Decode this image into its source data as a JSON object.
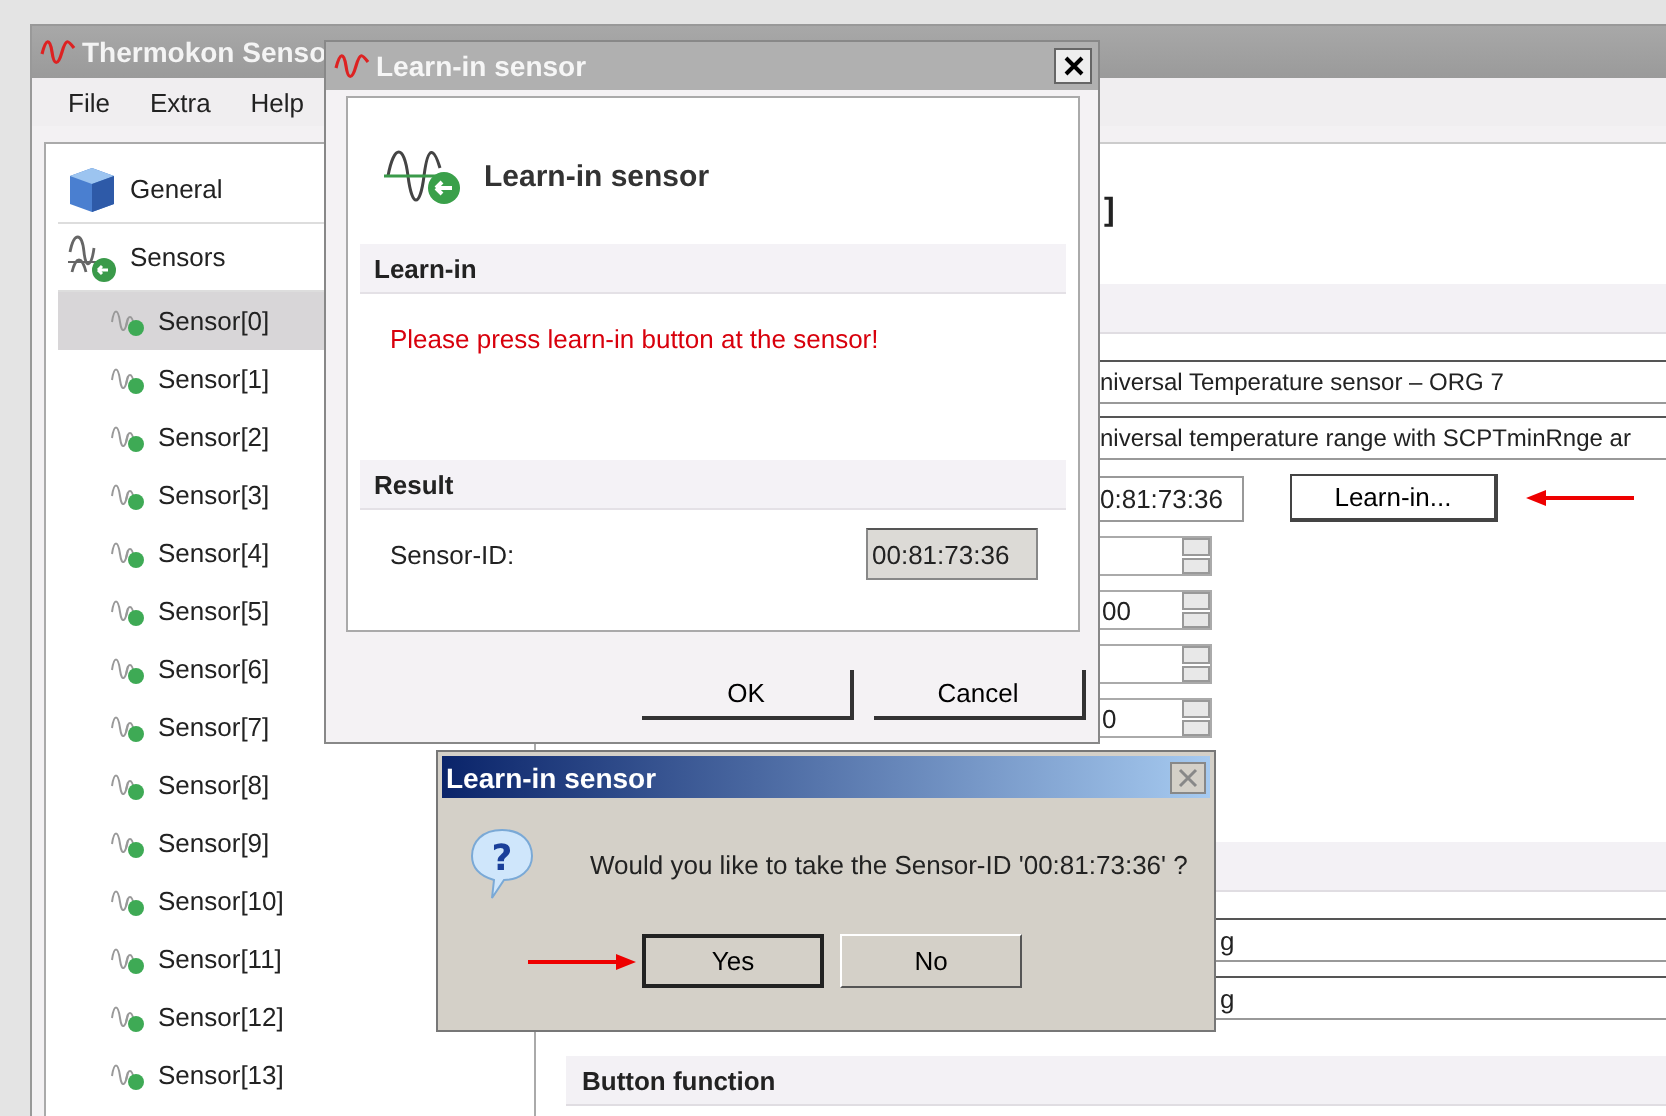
{
  "main_window": {
    "title": "Thermokon Senso",
    "menu": [
      "File",
      "Extra",
      "Help"
    ],
    "sidebar": {
      "items": [
        {
          "label": "General",
          "kind": "general",
          "selected": false
        },
        {
          "label": "Sensors",
          "kind": "group",
          "selected": false,
          "children": [
            {
              "label": "Sensor[0]",
              "selected": true
            },
            {
              "label": "Sensor[1]",
              "selected": false
            },
            {
              "label": "Sensor[2]",
              "selected": false
            },
            {
              "label": "Sensor[3]",
              "selected": false
            },
            {
              "label": "Sensor[4]",
              "selected": false
            },
            {
              "label": "Sensor[5]",
              "selected": false
            },
            {
              "label": "Sensor[6]",
              "selected": false
            },
            {
              "label": "Sensor[7]",
              "selected": false
            },
            {
              "label": "Sensor[8]",
              "selected": false
            },
            {
              "label": "Sensor[9]",
              "selected": false
            },
            {
              "label": "Sensor[10]",
              "selected": false
            },
            {
              "label": "Sensor[11]",
              "selected": false
            },
            {
              "label": "Sensor[12]",
              "selected": false
            },
            {
              "label": "Sensor[13]",
              "selected": false
            }
          ]
        }
      ]
    },
    "content": {
      "heading": "]",
      "fields": [
        "niversal Temperature sensor – ORG 7",
        "niversal temperature range with SCPTminRnge ar"
      ],
      "sensor_id": "0:81:73:36",
      "learn_button": "Learn-in...",
      "spinners": [
        {
          "kind": "blank"
        },
        {
          "kind": "value",
          "value": "00"
        },
        {
          "kind": "blank"
        },
        {
          "kind": "value",
          "value": "0"
        }
      ],
      "lower_fields": [
        "g",
        "g"
      ],
      "section": "Button function"
    }
  },
  "learn_dialog": {
    "title": "Learn-in sensor",
    "heading": "Learn-in sensor",
    "learn_section": "Learn-in",
    "message": "Please press learn-in button at the sensor!",
    "result_section": "Result",
    "id_label": "Sensor-ID:",
    "id_value": "00:81:73:36",
    "buttons": [
      "OK",
      "Cancel"
    ]
  },
  "confirm_dialog": {
    "title": "Learn-in sensor",
    "icon_glyph": "?",
    "message": "Would you like to take the Sensor-ID '00:81:73:36' ?",
    "buttons": [
      {
        "label": "Yes",
        "selected": true
      },
      {
        "label": "No",
        "selected": false
      }
    ]
  }
}
